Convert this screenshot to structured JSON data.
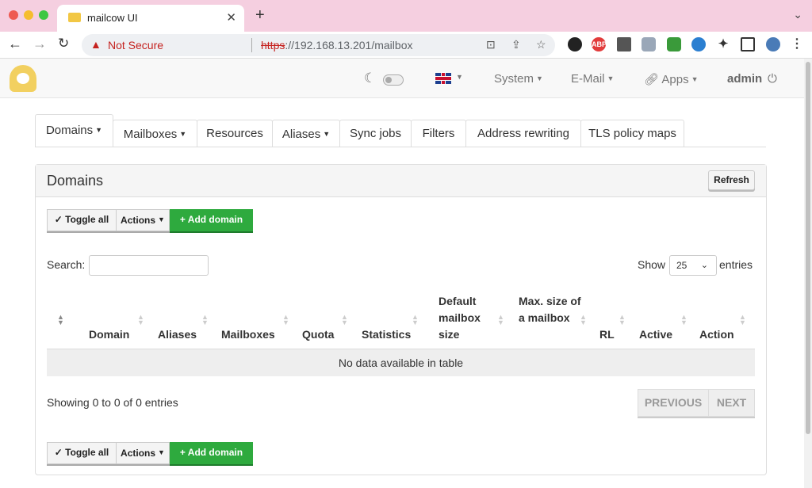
{
  "browser": {
    "tab_title": "mailcow UI",
    "url_warning": "Not Secure",
    "url_protocol": "https",
    "url_rest": "://192.168.13.201/mailbox"
  },
  "nav": {
    "system": "System",
    "email": "E-Mail",
    "apps": "Apps",
    "user": "admin"
  },
  "tabs": [
    {
      "label": "Domains"
    },
    {
      "label": "Mailboxes"
    },
    {
      "label": "Resources"
    },
    {
      "label": "Aliases"
    },
    {
      "label": "Sync jobs"
    },
    {
      "label": "Filters"
    },
    {
      "label": "Address rewriting"
    },
    {
      "label": "TLS policy maps"
    }
  ],
  "panel": {
    "title": "Domains",
    "refresh": "Refresh",
    "toggle_all": "Toggle all",
    "actions": "Actions",
    "add_domain": "+ Add domain",
    "search_label": "Search:",
    "show_label": "Show",
    "entries_label": "entries",
    "page_size": "25",
    "columns": [
      "Domain",
      "Aliases",
      "Mailboxes",
      "Quota",
      "Statistics",
      "Default mailbox size",
      "Max. size of a mailbox",
      "RL",
      "Active",
      "Action"
    ],
    "empty_text": "No data available in table",
    "info_text": "Showing 0 to 0 of 0 entries",
    "previous": "PREVIOUS",
    "next": "NEXT"
  },
  "colors": {
    "accent_green": "#2eaa3e",
    "titlebar": "#f5cfe0"
  }
}
